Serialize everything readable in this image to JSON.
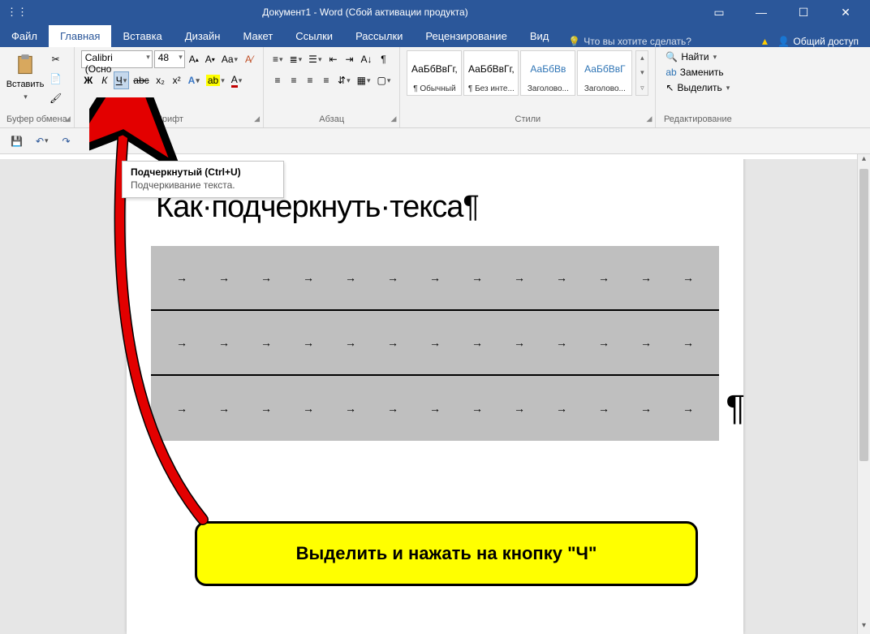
{
  "title": "Документ1 - Word (Сбой активации продукта)",
  "tabs": [
    "Файл",
    "Главная",
    "Вставка",
    "Дизайн",
    "Макет",
    "Ссылки",
    "Рассылки",
    "Рецензирование",
    "Вид"
  ],
  "active_tab": 1,
  "tell_me": "Что вы хотите сделать?",
  "share": "Общий доступ",
  "clipboard": {
    "paste": "Вставить",
    "label": "Буфер обмена"
  },
  "font": {
    "name": "Calibri (Осно",
    "size": "48",
    "buttons": {
      "grow": "A▲",
      "shrink": "A▼",
      "case": "Aa",
      "clear": "✕"
    },
    "row2": {
      "bold": "Ж",
      "italic": "К",
      "underline": "Ч",
      "strike": "abc",
      "sub": "x₂",
      "sup": "x²",
      "effects": "A",
      "highlight": "ab",
      "color": "A"
    },
    "label": "Шрифт"
  },
  "paragraph": {
    "label": "Абзац"
  },
  "styles": {
    "items": [
      {
        "preview": "АаБбВвГг,",
        "name": "¶ Обычный",
        "color": "#000"
      },
      {
        "preview": "АаБбВвГг,",
        "name": "¶ Без инте...",
        "color": "#000"
      },
      {
        "preview": "АаБбВв",
        "name": "Заголово...",
        "color": "#2e74b5"
      },
      {
        "preview": "АаБбВвГ",
        "name": "Заголово...",
        "color": "#2e74b5"
      }
    ],
    "label": "Стили"
  },
  "editing": {
    "find": "Найти",
    "replace": "Заменить",
    "select": "Выделить",
    "label": "Редактирование"
  },
  "tooltip": {
    "title": "Подчеркнутый (Ctrl+U)",
    "body": "Подчеркивание текста."
  },
  "document": {
    "heading": "Как·подчеркнуть·текса¶"
  },
  "callout": "Выделить и нажать на кнопку \"Ч\"",
  "qat": {
    "save": "💾",
    "undo": "↶",
    "redo": "↷"
  }
}
